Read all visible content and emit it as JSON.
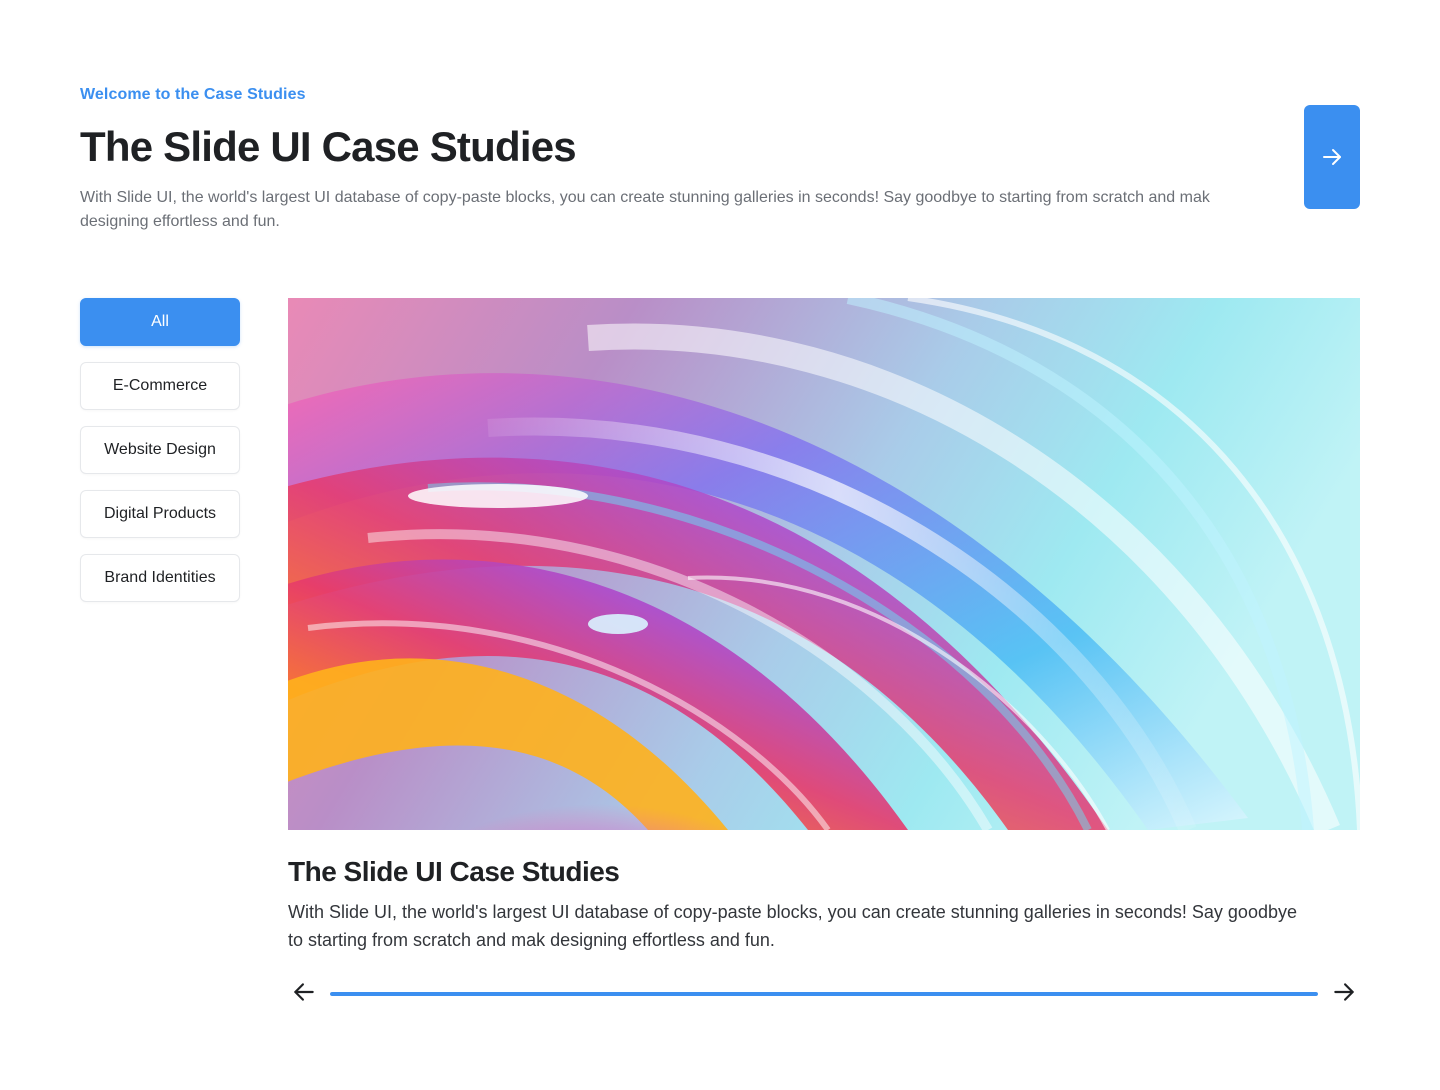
{
  "header": {
    "eyebrow": "Welcome to the Case Studies",
    "title": "The Slide UI Case Studies",
    "description": "With Slide UI, the world's largest UI database of copy-paste blocks, you can create stunning galleries in seconds! Say goodbye to starting from scratch and mak designing effortless and fun.",
    "next_icon": "arrow-right-icon"
  },
  "filters": {
    "items": [
      {
        "label": "All",
        "active": true
      },
      {
        "label": "E-Commerce",
        "active": false
      },
      {
        "label": "Website Design",
        "active": false
      },
      {
        "label": "Digital Products",
        "active": false
      },
      {
        "label": "Brand Identities",
        "active": false
      }
    ]
  },
  "card": {
    "image": "abstract-iridescent-swirl-image",
    "title": "The Slide UI Case Studies",
    "description": "With Slide UI, the world's largest UI database of copy-paste blocks, you can create stunning galleries in seconds! Say goodbye to starting from scratch and mak designing effortless and fun."
  },
  "slider": {
    "prev_icon": "arrow-left-icon",
    "next_icon": "arrow-right-icon",
    "progress": 1.0
  },
  "colors": {
    "accent": "#3b8ff0",
    "heading": "#1f2124",
    "body_text": "#6b6f76",
    "border": "#e6e8eb"
  }
}
